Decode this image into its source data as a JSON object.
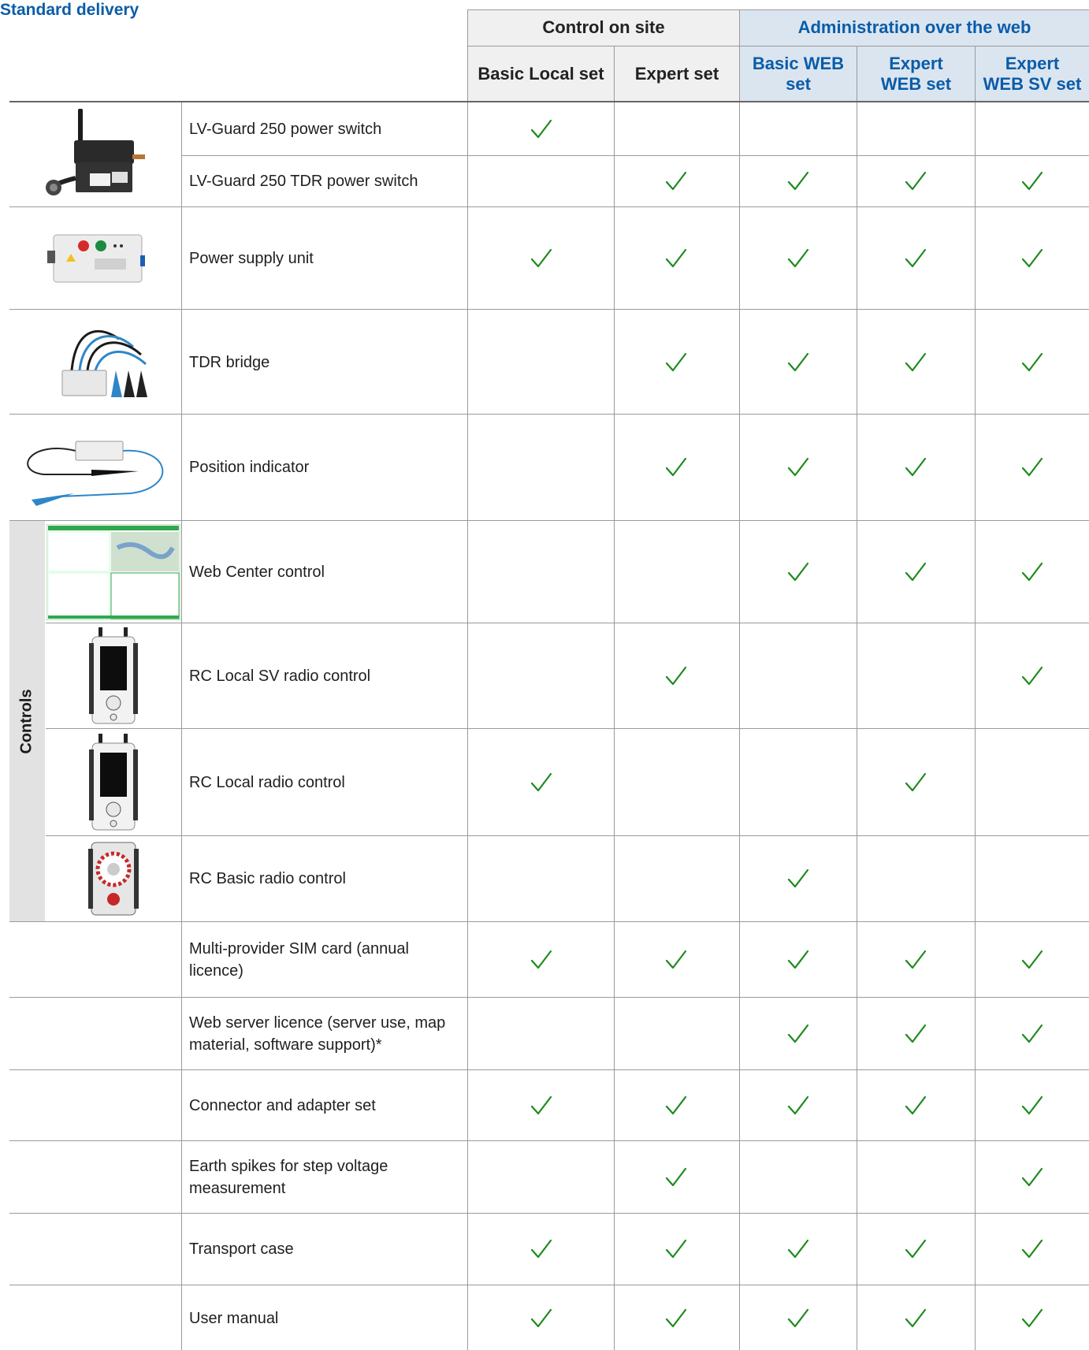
{
  "page_title": "Standard delivery",
  "header": {
    "group_site": "Control on site",
    "group_web": "Administration over the web",
    "columns": [
      {
        "line1": "Basic Local set",
        "line2": ""
      },
      {
        "line1": "Expert set",
        "line2": ""
      },
      {
        "line1": "Basic WEB",
        "line2": "set"
      },
      {
        "line1": "Expert",
        "line2": "WEB set"
      },
      {
        "line1": "Expert",
        "line2": "WEB SV set"
      }
    ]
  },
  "controls_label": "Controls",
  "check_color": "#1e8a1e",
  "rows": [
    {
      "label": "LV-Guard 250 power switch",
      "checks": [
        true,
        false,
        false,
        false,
        false
      ]
    },
    {
      "label": "LV-Guard 250 TDR power switch",
      "checks": [
        false,
        true,
        true,
        true,
        true
      ]
    },
    {
      "label": "Power supply unit",
      "checks": [
        true,
        true,
        true,
        true,
        true
      ]
    },
    {
      "label": "TDR bridge",
      "checks": [
        false,
        true,
        true,
        true,
        true
      ]
    },
    {
      "label": "Position indicator",
      "checks": [
        false,
        true,
        true,
        true,
        true
      ]
    },
    {
      "label": "Web Center control",
      "checks": [
        false,
        false,
        true,
        true,
        true
      ]
    },
    {
      "label": "RC Local SV radio control",
      "checks": [
        false,
        true,
        false,
        false,
        true
      ]
    },
    {
      "label": "RC Local radio control",
      "checks": [
        true,
        false,
        false,
        true,
        false
      ]
    },
    {
      "label": "RC Basic radio control",
      "checks": [
        false,
        false,
        true,
        false,
        false
      ]
    },
    {
      "label": "Multi-provider SIM card (annual licence)",
      "checks": [
        true,
        true,
        true,
        true,
        true
      ]
    },
    {
      "label": "Web server licence (server use, map material, software support)*",
      "checks": [
        false,
        false,
        true,
        true,
        true
      ]
    },
    {
      "label": "Connector and adapter set",
      "checks": [
        true,
        true,
        true,
        true,
        true
      ]
    },
    {
      "label": "Earth spikes for step voltage measurement",
      "checks": [
        false,
        true,
        false,
        false,
        true
      ]
    },
    {
      "label": "Transport case",
      "checks": [
        true,
        true,
        true,
        true,
        true
      ]
    },
    {
      "label": "User manual",
      "checks": [
        true,
        true,
        true,
        true,
        true
      ]
    }
  ]
}
